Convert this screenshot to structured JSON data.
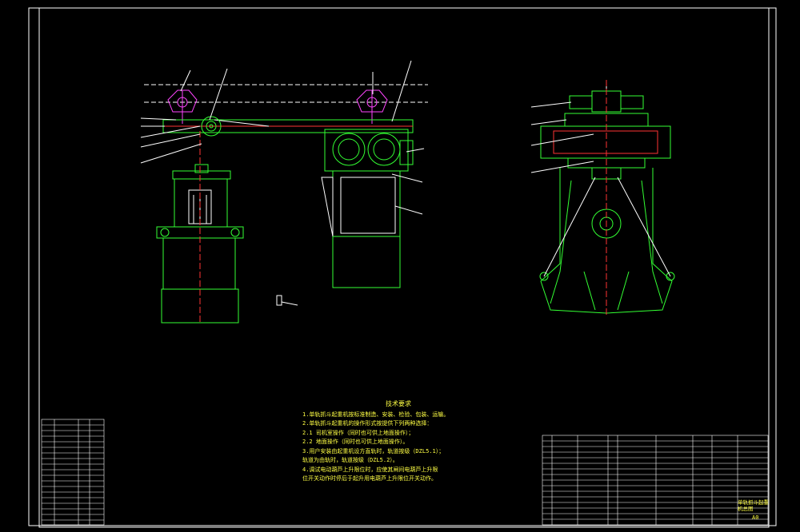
{
  "colors": {
    "background": "#000000",
    "frame": "#ffffff",
    "outline": "#33ff33",
    "centerline": "#ff3333",
    "text": "#ffff44",
    "leader": "#ffffff",
    "table_line": "#ffffff"
  },
  "notes": {
    "title": "技术要求",
    "lines": [
      "1.单轨抓斗起重机按标准制造、安装、检验、包装、运输。",
      "2.单轨抓斗起重机的操作形式按提供下列两种选择：",
      "2.1 司机室操作（同时也可供上地面操作）；",
      "2.2 地面操作（同时也可供上地面操作）。",
      "3.用户安装由起重机设方直轨时，轨道按级（DZL5.1）；",
      "  轨道为由轨时，轨道按级（DZL5.2）。",
      "4.调试电动葫芦上升限位时，应使其闸间电葫芦上升限",
      "  位开关动作时停后于起升用电葫芦上升限位开关动作。"
    ]
  },
  "title_block": {
    "title": "单轨抓斗起重机总图",
    "sheet": "A0"
  }
}
